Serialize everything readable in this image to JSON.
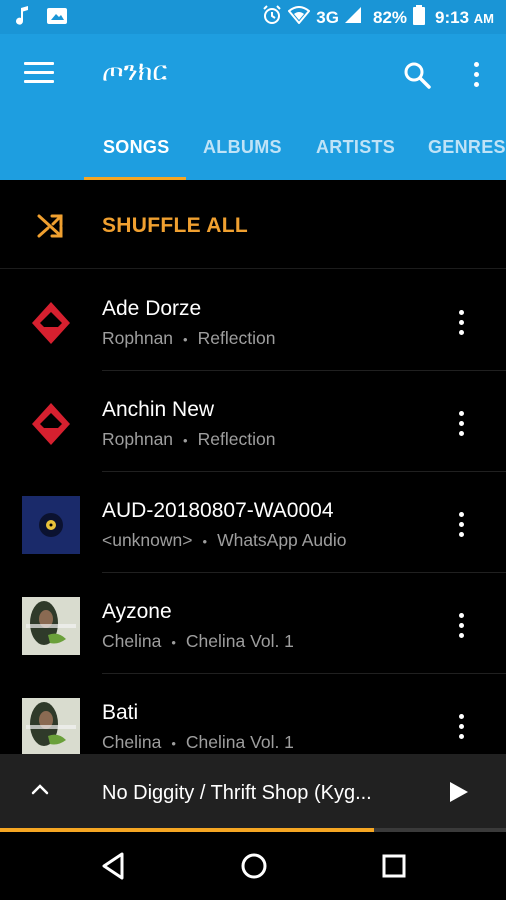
{
  "status_bar": {
    "signal_label": "3G",
    "battery": "82%",
    "time": "9:13",
    "ampm": "AM"
  },
  "app_bar": {
    "title": "ጦንክር"
  },
  "tabs": [
    {
      "label": "SONGS",
      "active": true
    },
    {
      "label": "ALBUMS",
      "active": false
    },
    {
      "label": "ARTISTS",
      "active": false
    },
    {
      "label": "GENRES",
      "active": false
    }
  ],
  "shuffle": {
    "label": "SHUFFLE ALL"
  },
  "songs": [
    {
      "title": "Ade Dorze",
      "artist": "Rophnan",
      "album": "Reflection",
      "art": "rophnan-logo"
    },
    {
      "title": "Anchin New",
      "artist": "Rophnan",
      "album": "Reflection",
      "art": "rophnan-logo"
    },
    {
      "title": "AUD-20180807-WA0004",
      "artist": "<unknown>",
      "album": "WhatsApp Audio",
      "art": "vinyl-disc"
    },
    {
      "title": "Ayzone",
      "artist": "Chelina",
      "album": "Chelina Vol. 1",
      "art": "chelina-cover"
    },
    {
      "title": "Bati",
      "artist": "Chelina",
      "album": "Chelina Vol. 1",
      "art": "chelina-cover"
    }
  ],
  "separator": "•",
  "now_playing": {
    "title": "No Diggity / Thrift Shop (Kyg...",
    "progress_fraction": 0.74
  },
  "colors": {
    "app_bar": "#1e9ee0",
    "status_bar": "#1a95d6",
    "accent": "#f5a623",
    "background": "#000000"
  }
}
